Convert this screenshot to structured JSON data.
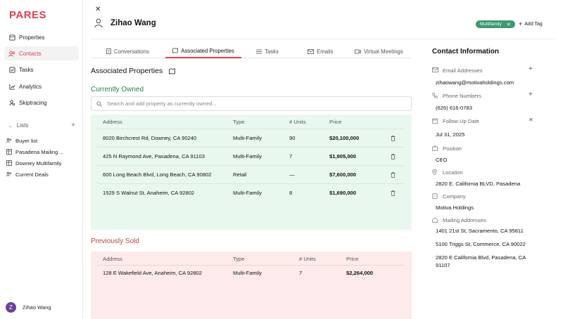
{
  "app": {
    "logo": "PARES"
  },
  "sidebar": {
    "items": [
      {
        "label": "Properties",
        "icon": "building-icon"
      },
      {
        "label": "Contacts",
        "icon": "contacts-icon"
      },
      {
        "label": "Tasks",
        "icon": "checkbox-icon"
      },
      {
        "label": "Analytics",
        "icon": "chart-icon"
      },
      {
        "label": "Skiptracing",
        "icon": "user-search-icon"
      }
    ],
    "lists_label": "Lists",
    "lists": [
      {
        "label": "Buyer list",
        "icon": "people-icon"
      },
      {
        "label": "Pasadena Mailing ...",
        "icon": "grid-icon"
      },
      {
        "label": "Downey Multifamily",
        "icon": "grid-icon"
      },
      {
        "label": "Current Deals",
        "icon": "people-icon"
      }
    ],
    "user": {
      "initial": "Z",
      "name": "Zihao Wang"
    }
  },
  "header": {
    "contact_name": "Zihao Wang",
    "tag": "Multifamily",
    "add_tag": "Add Tag"
  },
  "tabs": [
    {
      "label": "Conversations",
      "icon": "doc-icon"
    },
    {
      "label": "Associated Properties",
      "icon": "map-icon"
    },
    {
      "label": "Tasks",
      "icon": "list-icon"
    },
    {
      "label": "Emails",
      "icon": "mail-icon"
    },
    {
      "label": "Virtual Meetings",
      "icon": "video-icon"
    }
  ],
  "section_title": "Associated Properties",
  "owned": {
    "title": "Currently Owned",
    "search_placeholder": "Search and add property as currently owned...",
    "headers": {
      "address": "Address",
      "type": "Type",
      "units": "# Units",
      "price": "Price"
    },
    "rows": [
      {
        "address": "8020 Birchcrest Rd, Downey, CA 90240",
        "type": "Multi-Family",
        "units": "90",
        "price": "$20,100,000"
      },
      {
        "address": "425 N Raymond Ave, Pasadena, CA 91103",
        "type": "Multi-Family",
        "units": "7",
        "price": "$1,905,000"
      },
      {
        "address": "600 Long Beach Blvd, Long Beach, CA 90802",
        "type": "Retail",
        "units": "—",
        "price": "$7,600,000"
      },
      {
        "address": "1529 S Walnut St, Anaheim, CA 92802",
        "type": "Multi-Family",
        "units": "8",
        "price": "$1,690,000"
      }
    ]
  },
  "sold": {
    "title": "Previously Sold",
    "headers": {
      "address": "Address",
      "type": "Type",
      "units": "# Units",
      "price": "Price"
    },
    "rows": [
      {
        "address": "128 E Wakefield Ave, Anaheim, CA 92802",
        "type": "Multi-Family",
        "units": "7",
        "price": "$2,264,000"
      }
    ]
  },
  "contact_info": {
    "title": "Contact Information",
    "email_label": "Email Addresses",
    "email": "zihaowang@motivaholdings.com",
    "phone_label": "Phone Numbers",
    "phone": "(626) 616-0783",
    "follow_label": "Follow Up Date",
    "follow": "Jul 31, 2025",
    "position_label": "Position",
    "position": "CEO",
    "location_label": "Location",
    "location": "2820 E. California BLVD, Pasadena",
    "company_label": "Company",
    "company": "Motiva Holdings",
    "mailing_label": "Mailing Addresses",
    "mailing": [
      "1401 21st St, Sacramento, CA 95811",
      "5100 Triggs St, Commerce, CA 90022",
      "2820 E California Blvd, Pasadena, CA 91107"
    ]
  },
  "colors": {
    "brand": "#e0414d",
    "owned_bg": "#e9f8ee",
    "sold_bg": "#fcebea",
    "tag_bg": "#3d9a6e"
  }
}
